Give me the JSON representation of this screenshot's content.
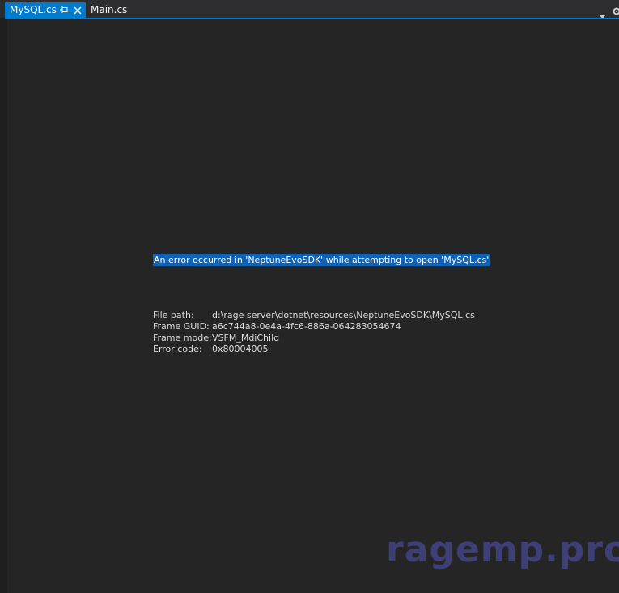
{
  "tabs": [
    {
      "label": "MySQL.cs",
      "active": true
    },
    {
      "label": "Main.cs",
      "active": false
    }
  ],
  "error": {
    "message": "An error occurred in 'NeptuneEvoSDK' while attempting to open 'MySQL.cs'",
    "details": [
      {
        "key": "File path:",
        "value": "d:\\rage server\\dotnet\\resources\\NeptuneEvoSDK\\MySQL.cs"
      },
      {
        "key": "Frame GUID:",
        "value": "a6c744a8-0e4a-4fc6-886a-064283054674"
      },
      {
        "key": "Frame mode:",
        "value": "VSFM_MdiChild"
      },
      {
        "key": "Error code:",
        "value": "0x80004005"
      }
    ]
  },
  "watermark": "ragemp.pro",
  "colors": {
    "accent": "#007acc",
    "selection": "#0e63b7",
    "background": "#252526",
    "watermark": "#3f3f78"
  },
  "icons": [
    "pin-icon",
    "close-icon",
    "dropdown-icon",
    "gear-icon"
  ]
}
